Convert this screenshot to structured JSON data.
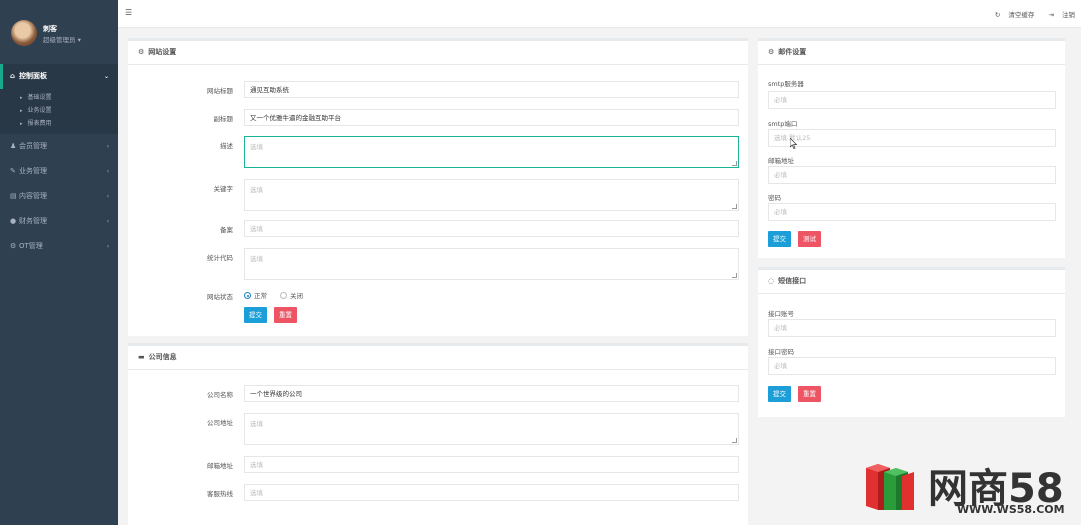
{
  "sidebar": {
    "user_name": "刺客",
    "user_role": "超级管理员",
    "menu": [
      {
        "label": "控制面板",
        "icon": "home-icon",
        "active": true
      },
      {
        "label": "会员管理",
        "icon": "users-icon"
      },
      {
        "label": "业务管理",
        "icon": "briefcase-icon"
      },
      {
        "label": "内容管理",
        "icon": "file-icon"
      },
      {
        "label": "财务管理",
        "icon": "money-icon"
      },
      {
        "label": "OT管理",
        "icon": "gear-icon"
      }
    ],
    "submenu": [
      "基础设置",
      "业务设置",
      "报表费用"
    ]
  },
  "topbar": {
    "clear_cache": "清空缓存",
    "logout": "注销"
  },
  "site_settings": {
    "title": "网站设置",
    "fields": {
      "site_title": {
        "label": "网站标题",
        "value": "通见互助系统"
      },
      "subtitle": {
        "label": "副标题",
        "value": "又一个优雅牛逼的金融互助平台"
      },
      "description": {
        "label": "描述",
        "placeholder": "选填"
      },
      "keywords": {
        "label": "关键字",
        "placeholder": "选填"
      },
      "icp": {
        "label": "备案",
        "placeholder": "选填"
      },
      "stats_code": {
        "label": "统计代码",
        "placeholder": "选填"
      },
      "status": {
        "label": "网站状态",
        "options": [
          "正常",
          "关闭"
        ],
        "selected": "正常"
      }
    },
    "submit": "提交",
    "reset": "重置"
  },
  "company_info": {
    "title": "公司信息",
    "fields": {
      "name": {
        "label": "公司名称",
        "value": "一个世界级的公司"
      },
      "address": {
        "label": "公司地址",
        "placeholder": "选填"
      },
      "email": {
        "label": "邮箱地址",
        "placeholder": "选填"
      },
      "hotline": {
        "label": "客服热线",
        "placeholder": "选填"
      }
    }
  },
  "mail_settings": {
    "title": "邮件设置",
    "fields": {
      "smtp_server": {
        "label": "smtp服务器",
        "placeholder": "必填"
      },
      "smtp_port": {
        "label": "smtp端口",
        "placeholder": "选填 默认25"
      },
      "mail_address": {
        "label": "邮箱地址",
        "placeholder": "必填"
      },
      "password": {
        "label": "密码",
        "placeholder": "必填"
      }
    },
    "submit": "提交",
    "test": "测试"
  },
  "sms_interface": {
    "title": "短信接口",
    "fields": {
      "account": {
        "label": "接口账号",
        "placeholder": "必填"
      },
      "password": {
        "label": "接口密码",
        "placeholder": "必填"
      }
    },
    "submit": "提交",
    "reset": "重置"
  },
  "watermark": {
    "brand": "网商58",
    "url": "WWW.WS58.COM"
  }
}
